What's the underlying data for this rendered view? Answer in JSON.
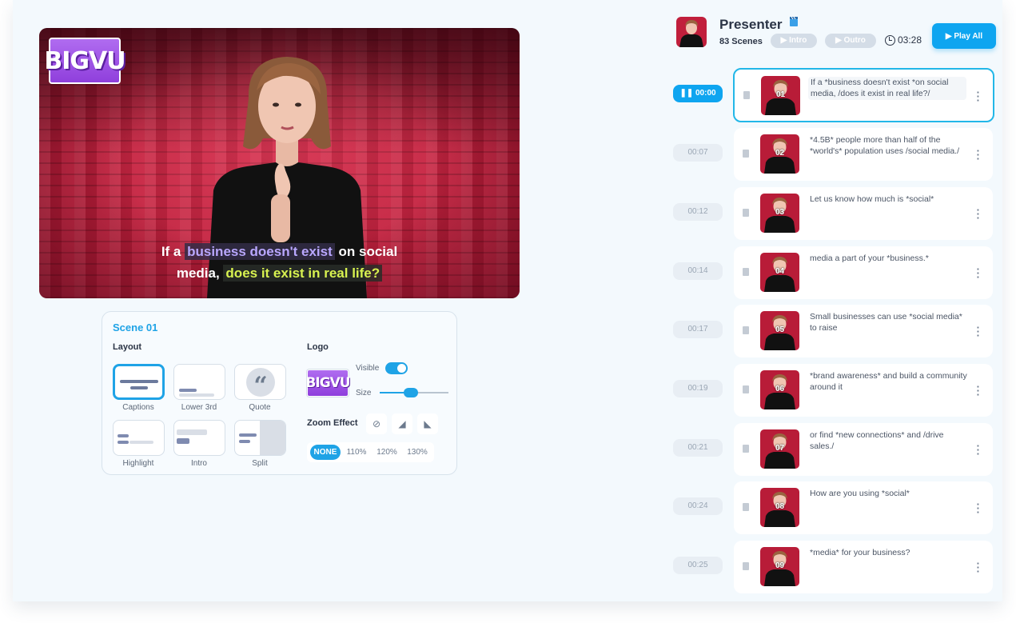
{
  "video": {
    "logo_text": "BIGVU",
    "caption_line1_pre": "If a",
    "caption_line1_hl": "business doesn't exist",
    "caption_line1_post": "on social",
    "caption_line2_pre": "media,",
    "caption_line2_hl": "does it exist in real life?"
  },
  "scene_panel": {
    "title": "Scene 01",
    "layout_label": "Layout",
    "layouts": [
      {
        "label": "Captions",
        "selected": true
      },
      {
        "label": "Lower 3rd",
        "selected": false
      },
      {
        "label": "Quote",
        "selected": false
      },
      {
        "label": "Highlight",
        "selected": false
      },
      {
        "label": "Intro",
        "selected": false
      },
      {
        "label": "Split",
        "selected": false
      }
    ],
    "logo_label": "Logo",
    "logo_thumb_text": "BIGVU",
    "visible_label": "Visible",
    "visible_on": true,
    "size_label": "Size",
    "size_value": 0.45,
    "zoom_label": "Zoom Effect",
    "zoom_options": [
      "NONE",
      "110%",
      "120%",
      "130%"
    ],
    "zoom_selected": "NONE"
  },
  "project": {
    "title": "Presenter",
    "scenes_count": "83 Scenes",
    "intro_label": "Intro",
    "outro_label": "Outro",
    "duration": "03:28",
    "play_all_label": "Play All"
  },
  "scenes": [
    {
      "time": "00:00",
      "num": "01",
      "text": "If a *business doesn't exist *on social media, /does it exist in real life?/",
      "active": true
    },
    {
      "time": "00:07",
      "num": "02",
      "text": "*4.5B* people more than half of the *world's* population uses /social media./",
      "active": false
    },
    {
      "time": "00:12",
      "num": "03",
      "text": "Let us know how much is *social*",
      "active": false
    },
    {
      "time": "00:14",
      "num": "04",
      "text": "media a part of your *business.*",
      "active": false
    },
    {
      "time": "00:17",
      "num": "05",
      "text": "Small businesses can use *social media* to raise",
      "active": false
    },
    {
      "time": "00:19",
      "num": "06",
      "text": "*brand awareness* and build a community around it",
      "active": false
    },
    {
      "time": "00:21",
      "num": "07",
      "text": "or find *new connections* and /drive sales./",
      "active": false
    },
    {
      "time": "00:24",
      "num": "08",
      "text": "How are you using *social*",
      "active": false
    },
    {
      "time": "00:25",
      "num": "09",
      "text": "*media* for your business?",
      "active": false
    }
  ],
  "colors": {
    "accent": "#0ea5f0",
    "video_bg": "#c11f3c",
    "caption_hl1": "#b9a7ff",
    "caption_hl2": "#d8f250"
  }
}
